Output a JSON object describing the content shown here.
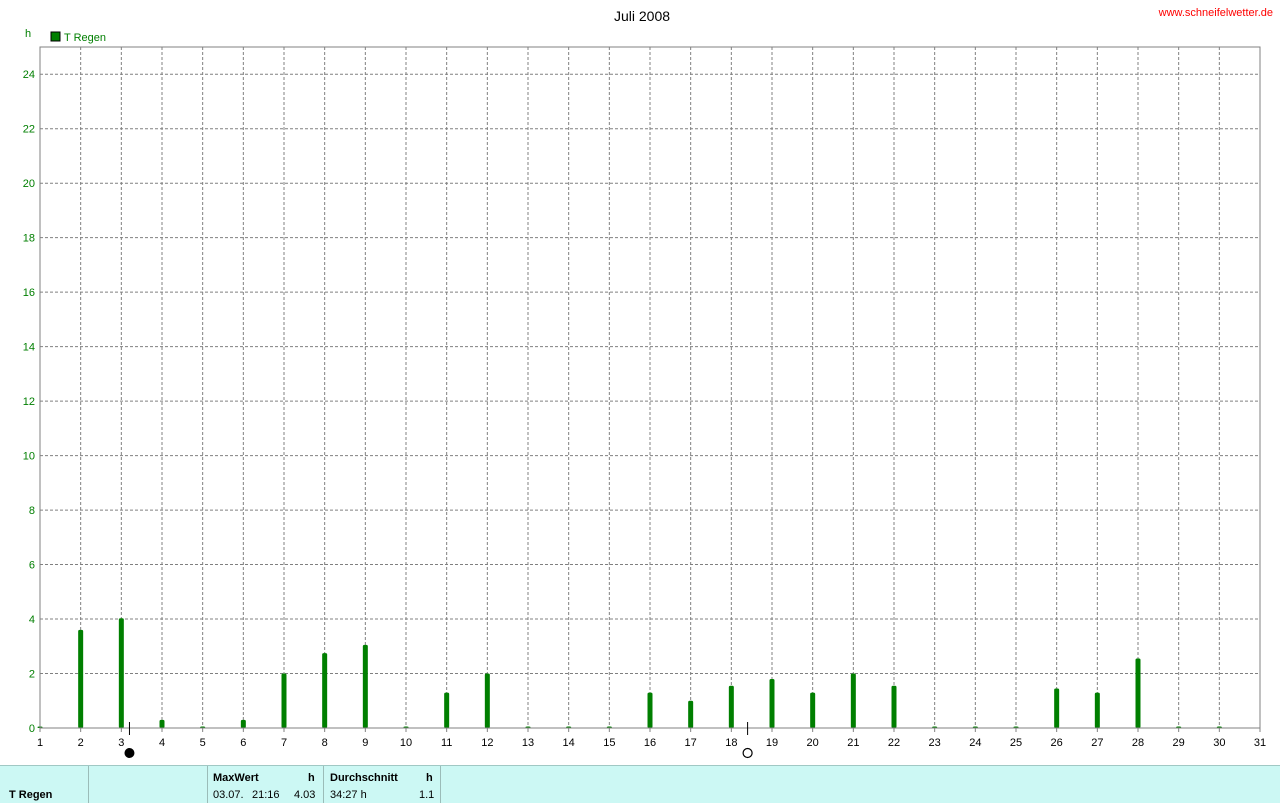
{
  "site_link": "www.schneifelwetter.de",
  "chart_data": {
    "type": "bar",
    "title": "Juli 2008",
    "ylabel": "h",
    "ylim": [
      0,
      25
    ],
    "yticks": [
      0,
      2,
      4,
      6,
      8,
      10,
      12,
      14,
      16,
      18,
      20,
      22,
      24
    ],
    "xlim": [
      1,
      31
    ],
    "categories": [
      "1",
      "2",
      "3",
      "4",
      "5",
      "6",
      "7",
      "8",
      "9",
      "10",
      "11",
      "12",
      "13",
      "14",
      "15",
      "16",
      "17",
      "18",
      "19",
      "20",
      "21",
      "22",
      "23",
      "24",
      "25",
      "26",
      "27",
      "28",
      "29",
      "30",
      "31"
    ],
    "legend_position": "top-left",
    "grid": true,
    "series": [
      {
        "name": "T Regen",
        "color": "#007f00",
        "x": [
          1,
          2,
          3,
          4,
          5,
          6,
          7,
          8,
          9,
          10,
          11,
          12,
          13,
          14,
          15,
          16,
          17,
          18,
          19,
          20,
          21,
          22,
          23,
          24,
          25,
          26,
          27,
          28,
          29,
          30
        ],
        "values": [
          0,
          3.6,
          4.03,
          0.3,
          0,
          0.3,
          2.0,
          2.75,
          3.05,
          0,
          1.3,
          2.0,
          0,
          0,
          0,
          1.3,
          1.0,
          1.55,
          1.8,
          1.3,
          2.0,
          1.55,
          0,
          0,
          0,
          1.45,
          1.3,
          2.55,
          0,
          0
        ]
      }
    ],
    "moon_phases": [
      {
        "day": 3.2,
        "phase": "new-moon"
      },
      {
        "day": 18.4,
        "phase": "full-moon"
      }
    ]
  },
  "footer": {
    "series_name": "T Regen",
    "max_header": "MaxWert",
    "max_unit": "h",
    "max_date": "03.07.",
    "max_time": "21:16",
    "max_value": "4.03",
    "avg_header": "Durchschnitt",
    "avg_unit": "h",
    "avg_total": "34:27 h",
    "avg_value": "1.1"
  }
}
